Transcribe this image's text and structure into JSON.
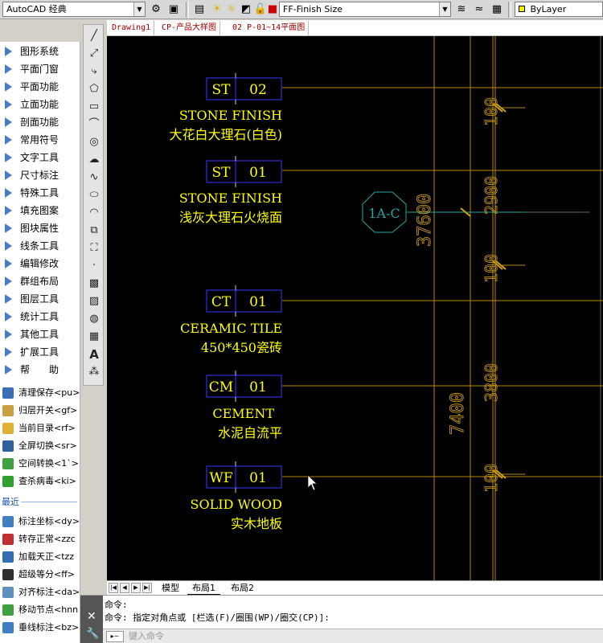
{
  "toolbar": {
    "workspace": "AutoCAD 经典",
    "layer": "FF-Finish Size",
    "linetype": "ByLayer"
  },
  "doc_tabs": [
    "Drawing1",
    "CP-产品大样图",
    "02 P-01~14平面图"
  ],
  "menu": [
    "图形系统",
    "平面门窗",
    "平面功能",
    "立面功能",
    "剖面功能",
    "常用符号",
    "文字工具",
    "尺寸标注",
    "特殊工具",
    "填充图案",
    "图块属性",
    "线条工具",
    "编辑修改",
    "群组布局",
    "图层工具",
    "统计工具",
    "其他工具",
    "扩展工具",
    "帮　　助"
  ],
  "commands": [
    {
      "label": "清理保存<pu>",
      "color": "#3a6fb8"
    },
    {
      "label": "归层开关<gf>",
      "color": "#c8a040"
    },
    {
      "label": "当前目录<rf>",
      "color": "#e0b030"
    },
    {
      "label": "全屏切换<sr>",
      "color": "#3060a0"
    },
    {
      "label": "空间转换<1`>",
      "color": "#40a040"
    },
    {
      "label": "查杀病毒<ki>",
      "color": "#30a030"
    }
  ],
  "recent_label": "最近",
  "recent": [
    {
      "label": "标注坐标<dy>",
      "color": "#4080c0"
    },
    {
      "label": "转存正常<zzc",
      "color": "#c03030"
    },
    {
      "label": "加载天正<tzz",
      "color": "#3070b0"
    },
    {
      "label": "超级等分<ff>",
      "color": "#303030"
    },
    {
      "label": "对齐标注<da>",
      "color": "#6090c0"
    },
    {
      "label": "移动节点<hnn",
      "color": "#40a040"
    },
    {
      "label": "垂线标注<bz>",
      "color": "#4080c0"
    }
  ],
  "drawing": {
    "tags": [
      {
        "code": "ST",
        "num": "02",
        "en": "STONE FINISH",
        "cn": "大花白大理石(白色)"
      },
      {
        "code": "ST",
        "num": "01",
        "en": "STONE FINISH",
        "cn": "浅灰大理石火烧面"
      },
      {
        "code": "CT",
        "num": "01",
        "en": "CERAMIC TILE",
        "cn": "450*450瓷砖"
      },
      {
        "code": "CM",
        "num": "01",
        "en": "CEMENT",
        "cn": "水泥自流平"
      },
      {
        "code": "WF",
        "num": "01",
        "en": "SOLID WOOD",
        "cn": "实木地板"
      }
    ],
    "section_marker": "1A-C",
    "dims": [
      "100",
      "2900",
      "100",
      "3800",
      "100",
      "37600",
      "7400"
    ]
  },
  "layout_tabs": [
    "模型",
    "布局1",
    "布局2"
  ],
  "command_lines": [
    "命令:",
    "命令: 指定对角点或 [栏选(F)/圈围(WP)/圈交(CP)]:"
  ],
  "command_placeholder": "键入命令"
}
